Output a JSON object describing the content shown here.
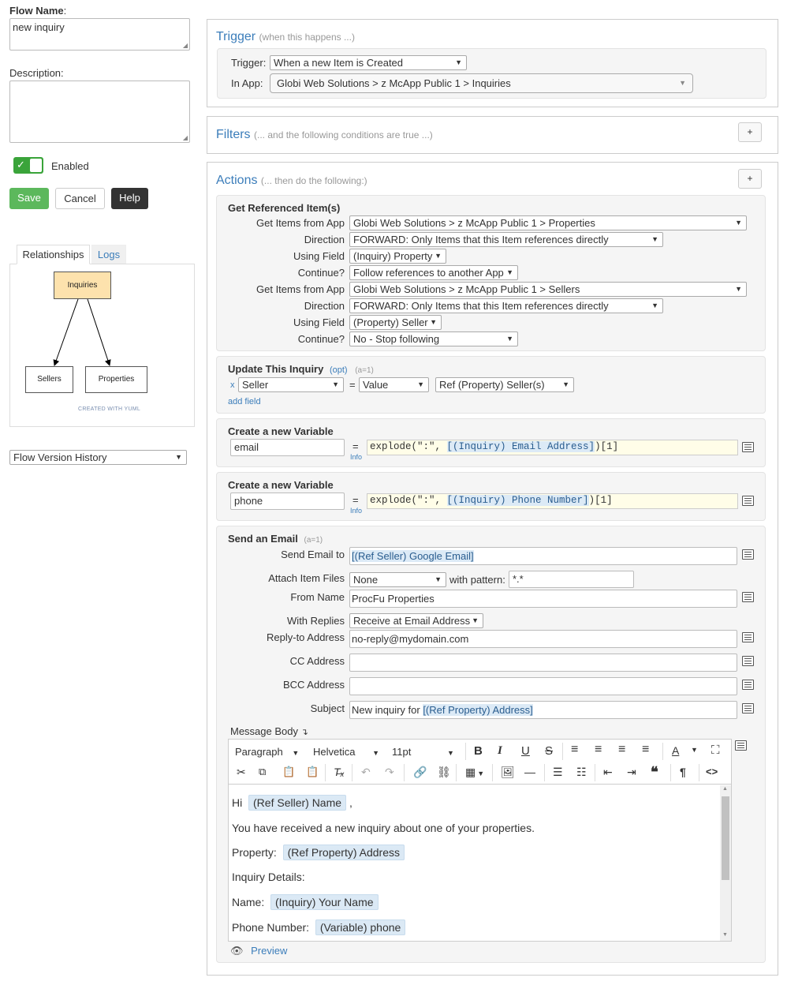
{
  "left": {
    "flow_name_label": "Flow Name",
    "flow_name_colon": ":",
    "flow_name_value": "new inquiry",
    "description_label": "Description:",
    "description_value": "",
    "enabled_label": "Enabled",
    "enabled": true,
    "save_label": "Save",
    "cancel_label": "Cancel",
    "help_label": "Help",
    "tabs": [
      "Relationships",
      "Logs"
    ],
    "diagram": {
      "root": "Inquiries",
      "children": [
        "Sellers",
        "Properties"
      ],
      "credit": "CREATED WITH YUML"
    },
    "version_history": "Flow Version History"
  },
  "trigger": {
    "title": "Trigger",
    "subtitle": "(when this happens ...)",
    "trigger_label": "Trigger:",
    "trigger_value": "When a new Item is Created",
    "app_label": "In App:",
    "app_value": "Globi Web Solutions > z McApp Public 1 > Inquiries"
  },
  "filters": {
    "title": "Filters",
    "subtitle": "(... and the following conditions are true ...)",
    "plus": "+"
  },
  "actions": {
    "title": "Actions",
    "subtitle": "(... then do the following:)",
    "plus": "+",
    "get_ref": {
      "title": "Get Referenced Item(s)",
      "rows": [
        {
          "label": "Get Items from App",
          "value": "Globi Web Solutions > z McApp Public 1 > Properties"
        },
        {
          "label": "Direction",
          "value": "FORWARD: Only Items that this Item references directly"
        },
        {
          "label": "Using Field",
          "value": "(Inquiry) Property"
        },
        {
          "label": "Continue?",
          "value": "Follow references to another App"
        },
        {
          "label": "Get Items from App",
          "value": "Globi Web Solutions > z McApp Public 1 > Sellers"
        },
        {
          "label": "Direction",
          "value": "FORWARD: Only Items that this Item references directly"
        },
        {
          "label": "Using Field",
          "value": "(Property) Seller"
        },
        {
          "label": "Continue?",
          "value": "No - Stop following"
        }
      ]
    },
    "update": {
      "title": "Update This Inquiry",
      "opt": "(opt)",
      "count": "(a=1)",
      "x": "x",
      "field": "Seller",
      "eq": "=",
      "mode": "Value",
      "value": "Ref (Property) Seller(s)",
      "add_field": "add field"
    },
    "var1": {
      "title": "Create a new Variable",
      "name": "email",
      "eq": "=",
      "info": "Info",
      "expr_pre": "explode(\":\", ",
      "expr_token": "[(Inquiry) Email Address]",
      "expr_post": ")[1]"
    },
    "var2": {
      "title": "Create a new Variable",
      "name": "phone",
      "eq": "=",
      "info": "Info",
      "expr_pre": "explode(\":\", ",
      "expr_token": "[(Inquiry) Phone Number]",
      "expr_post": ")[1]"
    },
    "email": {
      "title": "Send an Email",
      "count": "(a=1)",
      "send_to_label": "Send Email to",
      "send_to_value": "[(Ref Seller) Google Email]",
      "attach_label": "Attach Item Files",
      "attach_value": "None",
      "pattern_label": "with pattern:",
      "pattern_value": "*.*",
      "from_label": "From Name",
      "from_value": "ProcFu Properties",
      "replies_label": "With Replies",
      "replies_value": "Receive at Email Address",
      "replyto_label": "Reply-to Address",
      "replyto_value": "no-reply@mydomain.com",
      "cc_label": "CC Address",
      "cc_value": "",
      "bcc_label": "BCC Address",
      "bcc_value": "",
      "subject_label": "Subject",
      "subject_pre": "New inquiry for ",
      "subject_token": "[(Ref Property) Address]",
      "body_label": "Message Body",
      "body_arrow": "↴",
      "toolbar": {
        "format": "Paragraph",
        "font": "Helvetica",
        "size": "11pt"
      },
      "body": {
        "l1_pre": "Hi",
        "l1_chip": "(Ref Seller) Name",
        "l1_post": ",",
        "l2": "You have received a new inquiry about one of your properties.",
        "l3_pre": "Property:",
        "l3_chip": "(Ref Property) Address",
        "l4": "Inquiry Details:",
        "l5_pre": "Name:",
        "l5_chip": "(Inquiry) Your Name",
        "l6_pre": "Phone Number:",
        "l6_chip": "(Variable) phone"
      },
      "preview": "Preview"
    }
  },
  "colors": {
    "accent": "#3b7dba",
    "save": "#5cb85c",
    "help": "#333333",
    "diagram_root": "#fde2ad",
    "expr_bg": "#fffde8",
    "chip": "#dbe9f5"
  }
}
